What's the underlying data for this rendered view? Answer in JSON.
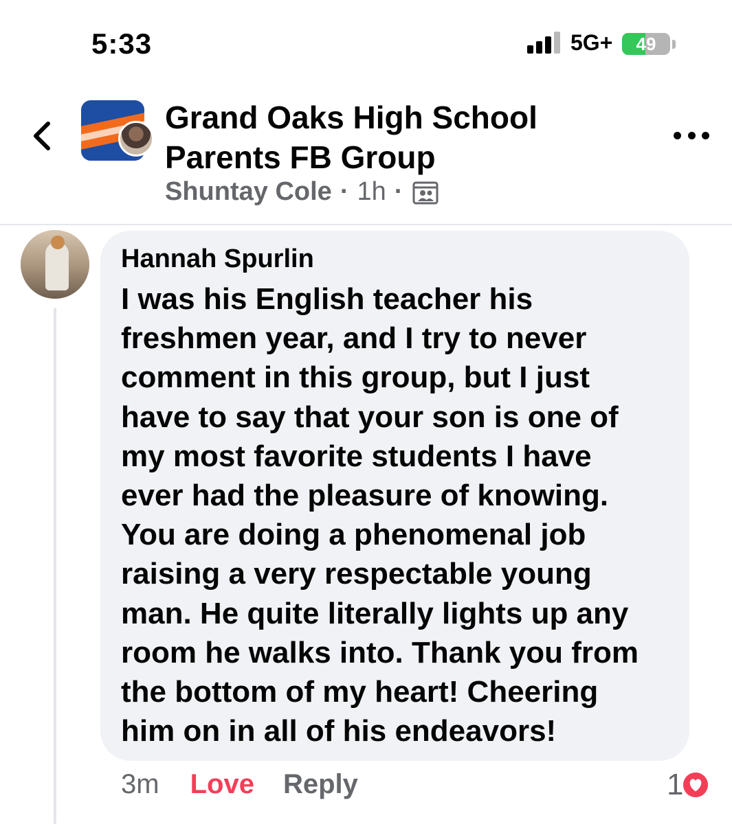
{
  "status_bar": {
    "time": "5:33",
    "network": "5G+",
    "battery_level": 49,
    "battery_label": "49"
  },
  "header": {
    "group_name_line1": "Grand Oaks High School",
    "group_name_line2": "Parents FB Group",
    "author": "Shuntay Cole",
    "separator": "·",
    "posted_ago": "1h",
    "icons": {
      "back": "chevron-left-icon",
      "more": "more-horizontal-icon",
      "audience": "group-members-icon"
    }
  },
  "comment": {
    "author": "Hannah Spurlin",
    "text": "I was his English teacher his\nfreshmen year, and I try to never\ncomment in this group, but I just\nhave to say that your son is one of\nmy most favorite students I have\never had the pleasure of knowing.\nYou are doing a phenomenal job\nraising a very respectable young\nman. He quite literally lights up any\nroom he walks into. Thank you from\nthe bottom of my heart! Cheering\nhim on in all of his endeavors!",
    "time_ago": "3m",
    "love_label": "Love",
    "reply_label": "Reply",
    "reaction_count": "1",
    "reaction_type": "love-reaction-icon"
  },
  "colors": {
    "love_red": "#f33e58",
    "secondary_text": "#65676b",
    "bubble_bg": "#f0f2f5",
    "battery_green": "#34c759"
  }
}
